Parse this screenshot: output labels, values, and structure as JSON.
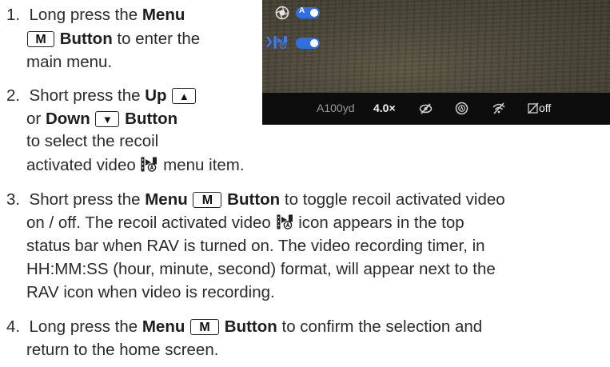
{
  "steps": [
    {
      "num": "1.",
      "a1": "Long press the ",
      "b1": "Menu",
      "key": "M",
      "b2": " Button",
      "a2": " to enter the",
      "a3": "main menu."
    },
    {
      "num": "2.",
      "a1": "Short press the ",
      "b1": "Up",
      "key_up": "▲",
      "a2": "or ",
      "b2": "Down",
      "key_down": "▼",
      "b3": " Button",
      "a3": "to select the recoil",
      "a4": "activated video",
      "a5": " menu item."
    },
    {
      "num": "3.",
      "a1": "Short press the ",
      "b1": "Menu",
      "key": "M",
      "b2": " Button",
      "a2": " to toggle recoil activated video",
      "l2": "on / off. The recoil activated video",
      "l2b": " icon appears in the top",
      "l3": "status bar when RAV is turned on. The video recording timer, in",
      "l4": "HH:MM:SS (hour, minute, second) format, will appear next to the",
      "l5": "RAV icon when video is recording."
    },
    {
      "num": "4.",
      "a1": "Long press the ",
      "b1": "Menu",
      "key": "M",
      "b2": " Button",
      "a2": " to confirm the selection and",
      "l2": "return to the home screen."
    }
  ],
  "screen": {
    "menu_toggle_label": "A",
    "status_range": "A100yd",
    "status_zoom": "4.0×",
    "status_off": "off"
  },
  "colors": {
    "toggle_on": "#2f6fe0",
    "status_bg": "#0d0d0d"
  }
}
